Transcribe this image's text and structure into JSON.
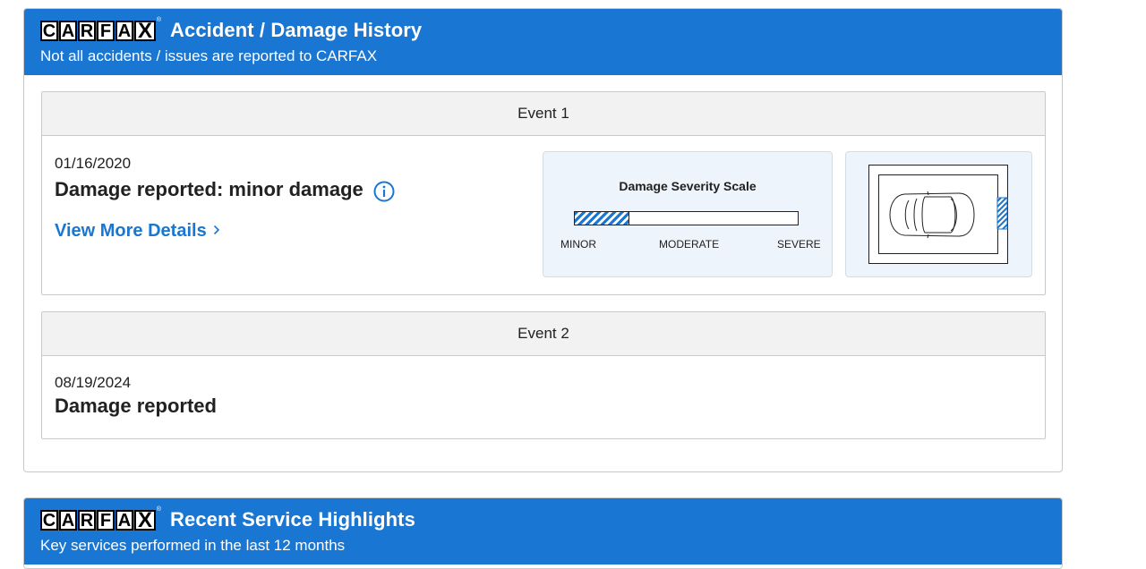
{
  "logo": {
    "letters": [
      "C",
      "A",
      "R",
      "F",
      "A",
      "X"
    ],
    "registered": "®"
  },
  "accident_section": {
    "title": "Accident / Damage History",
    "subtitle": "Not all accidents / issues are reported to CARFAX",
    "events": [
      {
        "header": "Event 1",
        "date": "01/16/2020",
        "description": "Damage reported: minor damage",
        "info_icon": "info-circle-icon",
        "link_label": "View More Details",
        "link_icon": "chevron-right-icon",
        "severity": {
          "title": "Damage Severity Scale",
          "level_fraction": 0.24,
          "labels": {
            "minor": "MINOR",
            "moderate": "MODERATE",
            "severe": "SEVERE"
          }
        },
        "impact_location": "rear"
      },
      {
        "header": "Event 2",
        "date": "08/19/2024",
        "description": "Damage reported"
      }
    ]
  },
  "service_section": {
    "title": "Recent Service Highlights",
    "subtitle": "Key services performed in the last 12 months"
  },
  "colors": {
    "header_blue": "#1976d2",
    "link_blue": "#1976d2",
    "panel_bg": "#eef4fb",
    "event_header_bg": "#f2f2f2"
  }
}
